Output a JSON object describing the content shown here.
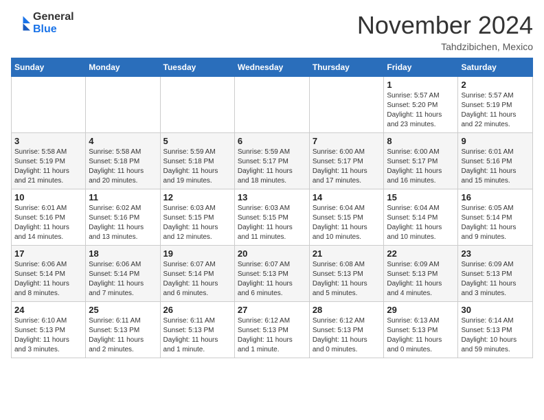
{
  "header": {
    "logo_general": "General",
    "logo_blue": "Blue",
    "month_title": "November 2024",
    "location": "Tahdzibichen, Mexico"
  },
  "calendar": {
    "days_of_week": [
      "Sunday",
      "Monday",
      "Tuesday",
      "Wednesday",
      "Thursday",
      "Friday",
      "Saturday"
    ],
    "weeks": [
      [
        {
          "day": "",
          "info": ""
        },
        {
          "day": "",
          "info": ""
        },
        {
          "day": "",
          "info": ""
        },
        {
          "day": "",
          "info": ""
        },
        {
          "day": "",
          "info": ""
        },
        {
          "day": "1",
          "info": "Sunrise: 5:57 AM\nSunset: 5:20 PM\nDaylight: 11 hours\nand 23 minutes."
        },
        {
          "day": "2",
          "info": "Sunrise: 5:57 AM\nSunset: 5:19 PM\nDaylight: 11 hours\nand 22 minutes."
        }
      ],
      [
        {
          "day": "3",
          "info": "Sunrise: 5:58 AM\nSunset: 5:19 PM\nDaylight: 11 hours\nand 21 minutes."
        },
        {
          "day": "4",
          "info": "Sunrise: 5:58 AM\nSunset: 5:18 PM\nDaylight: 11 hours\nand 20 minutes."
        },
        {
          "day": "5",
          "info": "Sunrise: 5:59 AM\nSunset: 5:18 PM\nDaylight: 11 hours\nand 19 minutes."
        },
        {
          "day": "6",
          "info": "Sunrise: 5:59 AM\nSunset: 5:17 PM\nDaylight: 11 hours\nand 18 minutes."
        },
        {
          "day": "7",
          "info": "Sunrise: 6:00 AM\nSunset: 5:17 PM\nDaylight: 11 hours\nand 17 minutes."
        },
        {
          "day": "8",
          "info": "Sunrise: 6:00 AM\nSunset: 5:17 PM\nDaylight: 11 hours\nand 16 minutes."
        },
        {
          "day": "9",
          "info": "Sunrise: 6:01 AM\nSunset: 5:16 PM\nDaylight: 11 hours\nand 15 minutes."
        }
      ],
      [
        {
          "day": "10",
          "info": "Sunrise: 6:01 AM\nSunset: 5:16 PM\nDaylight: 11 hours\nand 14 minutes."
        },
        {
          "day": "11",
          "info": "Sunrise: 6:02 AM\nSunset: 5:16 PM\nDaylight: 11 hours\nand 13 minutes."
        },
        {
          "day": "12",
          "info": "Sunrise: 6:03 AM\nSunset: 5:15 PM\nDaylight: 11 hours\nand 12 minutes."
        },
        {
          "day": "13",
          "info": "Sunrise: 6:03 AM\nSunset: 5:15 PM\nDaylight: 11 hours\nand 11 minutes."
        },
        {
          "day": "14",
          "info": "Sunrise: 6:04 AM\nSunset: 5:15 PM\nDaylight: 11 hours\nand 10 minutes."
        },
        {
          "day": "15",
          "info": "Sunrise: 6:04 AM\nSunset: 5:14 PM\nDaylight: 11 hours\nand 10 minutes."
        },
        {
          "day": "16",
          "info": "Sunrise: 6:05 AM\nSunset: 5:14 PM\nDaylight: 11 hours\nand 9 minutes."
        }
      ],
      [
        {
          "day": "17",
          "info": "Sunrise: 6:06 AM\nSunset: 5:14 PM\nDaylight: 11 hours\nand 8 minutes."
        },
        {
          "day": "18",
          "info": "Sunrise: 6:06 AM\nSunset: 5:14 PM\nDaylight: 11 hours\nand 7 minutes."
        },
        {
          "day": "19",
          "info": "Sunrise: 6:07 AM\nSunset: 5:14 PM\nDaylight: 11 hours\nand 6 minutes."
        },
        {
          "day": "20",
          "info": "Sunrise: 6:07 AM\nSunset: 5:13 PM\nDaylight: 11 hours\nand 6 minutes."
        },
        {
          "day": "21",
          "info": "Sunrise: 6:08 AM\nSunset: 5:13 PM\nDaylight: 11 hours\nand 5 minutes."
        },
        {
          "day": "22",
          "info": "Sunrise: 6:09 AM\nSunset: 5:13 PM\nDaylight: 11 hours\nand 4 minutes."
        },
        {
          "day": "23",
          "info": "Sunrise: 6:09 AM\nSunset: 5:13 PM\nDaylight: 11 hours\nand 3 minutes."
        }
      ],
      [
        {
          "day": "24",
          "info": "Sunrise: 6:10 AM\nSunset: 5:13 PM\nDaylight: 11 hours\nand 3 minutes."
        },
        {
          "day": "25",
          "info": "Sunrise: 6:11 AM\nSunset: 5:13 PM\nDaylight: 11 hours\nand 2 minutes."
        },
        {
          "day": "26",
          "info": "Sunrise: 6:11 AM\nSunset: 5:13 PM\nDaylight: 11 hours\nand 1 minute."
        },
        {
          "day": "27",
          "info": "Sunrise: 6:12 AM\nSunset: 5:13 PM\nDaylight: 11 hours\nand 1 minute."
        },
        {
          "day": "28",
          "info": "Sunrise: 6:12 AM\nSunset: 5:13 PM\nDaylight: 11 hours\nand 0 minutes."
        },
        {
          "day": "29",
          "info": "Sunrise: 6:13 AM\nSunset: 5:13 PM\nDaylight: 11 hours\nand 0 minutes."
        },
        {
          "day": "30",
          "info": "Sunrise: 6:14 AM\nSunset: 5:13 PM\nDaylight: 10 hours\nand 59 minutes."
        }
      ]
    ]
  }
}
